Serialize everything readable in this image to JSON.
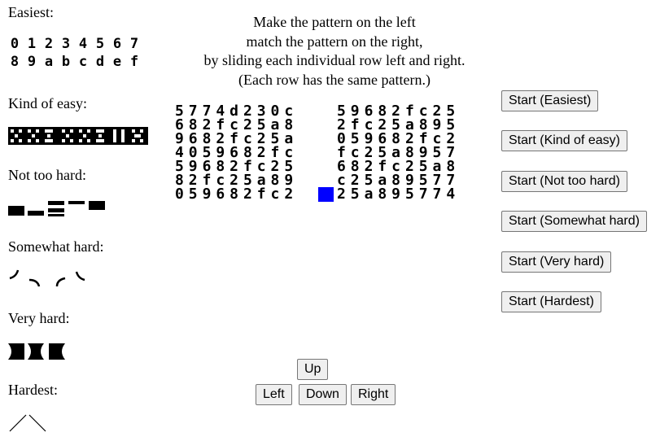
{
  "levels": [
    {
      "label": "Easiest:",
      "glyphs": [
        [
          "0",
          "1",
          "2",
          "3",
          "4",
          "5",
          "6",
          "7"
        ],
        [
          "8",
          "9",
          "a",
          "b",
          "c",
          "d",
          "e",
          "f"
        ]
      ]
    },
    {
      "label": "Kind of easy:"
    },
    {
      "label": "Not too hard:"
    },
    {
      "label": "Somewhat hard:"
    },
    {
      "label": "Very hard:"
    },
    {
      "label": "Hardest:"
    }
  ],
  "instructions": [
    "Make the pattern on the left",
    "match the pattern on the right,",
    "by sliding each individual row left and right.",
    "(Each row has the same pattern.)"
  ],
  "left_grid": [
    [
      "5",
      "7",
      "7",
      "4",
      "d",
      "2",
      "3",
      "0",
      "c"
    ],
    [
      "6",
      "8",
      "2",
      "f",
      "c",
      "2",
      "5",
      "a",
      "8"
    ],
    [
      "9",
      "6",
      "8",
      "2",
      "f",
      "c",
      "2",
      "5",
      "a"
    ],
    [
      "4",
      "0",
      "5",
      "9",
      "6",
      "8",
      "2",
      "f",
      "c"
    ],
    [
      "5",
      "9",
      "6",
      "8",
      "2",
      "f",
      "c",
      "2",
      "5"
    ],
    [
      "8",
      "2",
      "f",
      "c",
      "2",
      "5",
      "a",
      "8",
      "9"
    ],
    [
      "0",
      "5",
      "9",
      "6",
      "8",
      "2",
      "f",
      "c",
      "2"
    ]
  ],
  "right_grid": [
    [
      "5",
      "9",
      "6",
      "8",
      "2",
      "f",
      "c",
      "2",
      "5"
    ],
    [
      "2",
      "f",
      "c",
      "2",
      "5",
      "a",
      "8",
      "9",
      "5"
    ],
    [
      "0",
      "5",
      "9",
      "6",
      "8",
      "2",
      "f",
      "c",
      "2"
    ],
    [
      "f",
      "c",
      "2",
      "5",
      "a",
      "8",
      "9",
      "5",
      "7"
    ],
    [
      "6",
      "8",
      "2",
      "f",
      "c",
      "2",
      "5",
      "a",
      "8"
    ],
    [
      "c",
      "2",
      "5",
      "a",
      "8",
      "9",
      "5",
      "7",
      "7"
    ],
    [
      "2",
      "5",
      "a",
      "8",
      "9",
      "5",
      "7",
      "7",
      "4"
    ]
  ],
  "cursor": {
    "row": 6,
    "color": "#0000ff"
  },
  "start_buttons": [
    "Start (Easiest)",
    "Start (Kind of easy)",
    "Start (Not too hard)",
    "Start (Somewhat hard)",
    "Start (Very hard)",
    "Start (Hardest)"
  ],
  "controls": {
    "up": "Up",
    "left": "Left",
    "down": "Down",
    "right": "Right"
  }
}
